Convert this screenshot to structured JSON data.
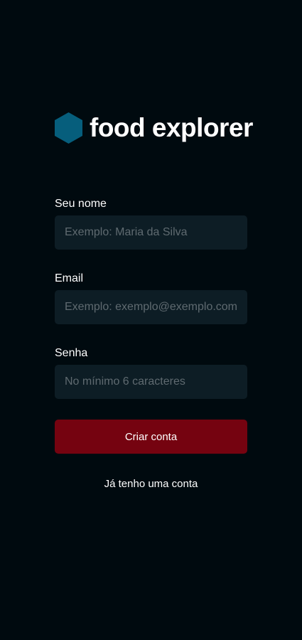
{
  "brand": {
    "name": "food explorer",
    "icon": "hexagon-logo-icon"
  },
  "form": {
    "name_field": {
      "label": "Seu nome",
      "placeholder": "Exemplo: Maria da Silva",
      "value": ""
    },
    "email_field": {
      "label": "Email",
      "placeholder": "Exemplo: exemplo@exemplo.com.br",
      "value": ""
    },
    "password_field": {
      "label": "Senha",
      "placeholder": "No mínimo 6 caracteres",
      "value": ""
    },
    "submit_label": "Criar conta",
    "login_link": "Já tenho uma conta"
  },
  "colors": {
    "background": "#000a0f",
    "input_background": "#0d1d25",
    "placeholder": "#5f6a70",
    "button": "#750310",
    "logo": "#065e7c",
    "text": "#ffffff"
  }
}
